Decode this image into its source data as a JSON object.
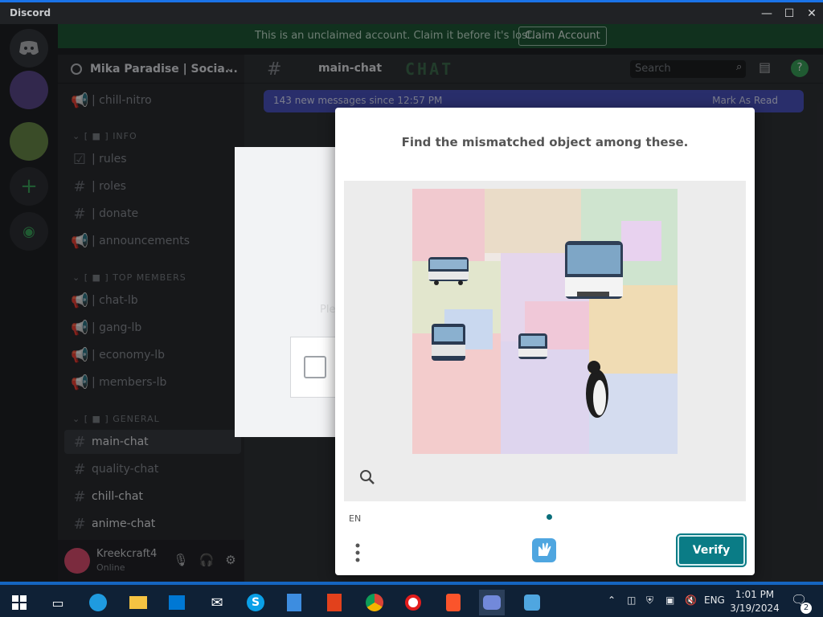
{
  "window": {
    "title": "Discord"
  },
  "banner": {
    "text": "This is an unclaimed account. Claim it before it's lost.",
    "button": "Claim Account"
  },
  "server": {
    "name": "Mika Paradise | Socia..."
  },
  "sidebar": {
    "channels": [
      {
        "label": "| chill-nitro"
      },
      {
        "label": "| rules"
      },
      {
        "label": "| roles"
      },
      {
        "label": "| donate"
      },
      {
        "label": "| announcements"
      },
      {
        "label": "| chat-lb"
      },
      {
        "label": "| gang-lb"
      },
      {
        "label": "| economy-lb"
      },
      {
        "label": "| members-lb"
      },
      {
        "label": "main-chat"
      },
      {
        "label": "quality-chat"
      },
      {
        "label": "chill-chat"
      },
      {
        "label": "anime-chat"
      }
    ],
    "categories": [
      {
        "label": "INFO"
      },
      {
        "label": "TOP MEMBERS"
      },
      {
        "label": "GENERAL"
      }
    ]
  },
  "user": {
    "name": "Kreekcraft4",
    "status": "Online"
  },
  "channel": {
    "name": "main-chat",
    "logo": "CHAT",
    "search_placeholder": "Search"
  },
  "new_messages": {
    "text": "143 new messages since 12:57 PM",
    "action": "Mark As Read"
  },
  "underlying_dialog": {
    "heading": "W",
    "text": "Ple"
  },
  "captcha": {
    "prompt": "Find the mismatched object among these.",
    "language": "EN",
    "verify_label": "Verify"
  },
  "taskbar": {
    "language": "ENG",
    "time": "1:01 PM",
    "date": "3/19/2024",
    "notifications": "2"
  },
  "colors": {
    "accent": "#0a7c86",
    "banner": "#1f5a37",
    "blurple": "#4c55c4"
  }
}
